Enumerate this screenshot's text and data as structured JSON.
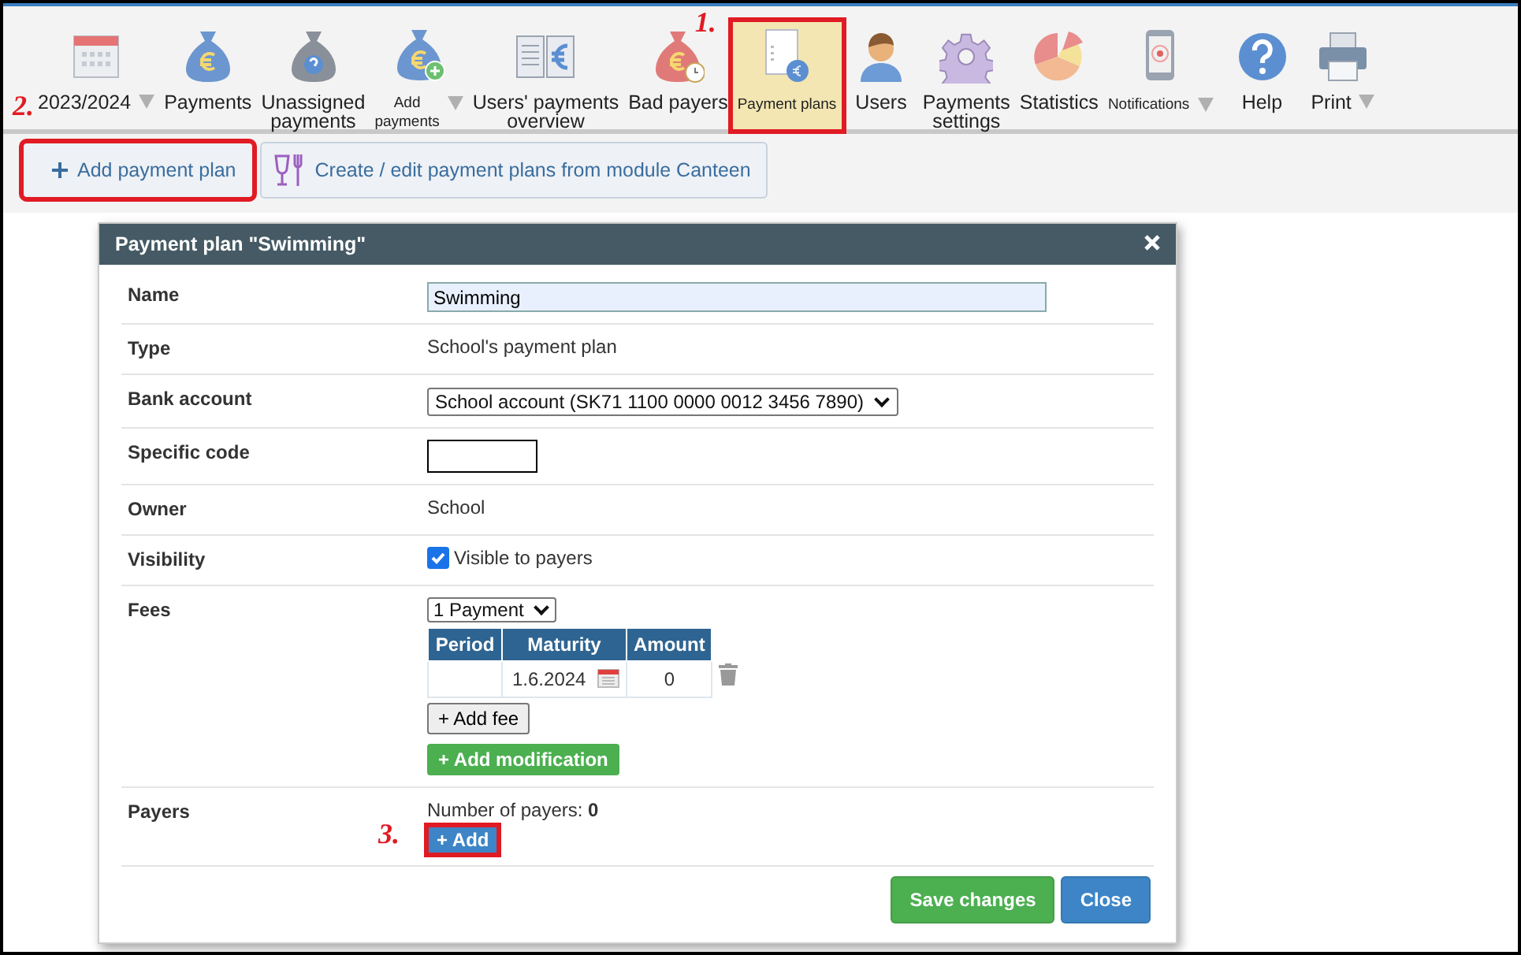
{
  "toolbar": {
    "items": [
      {
        "label": "2023/2024",
        "dropdown": true,
        "small": false,
        "selected": false,
        "marked": false
      },
      {
        "label": "Payments",
        "dropdown": false,
        "small": false,
        "selected": false,
        "marked": false
      },
      {
        "label": "Unassigned payments",
        "dropdown": false,
        "small": false,
        "selected": false,
        "marked": false
      },
      {
        "label": "Add payments",
        "dropdown": true,
        "small": true,
        "selected": false,
        "marked": false
      },
      {
        "label": "Users' payments overview",
        "dropdown": false,
        "small": false,
        "selected": false,
        "marked": false
      },
      {
        "label": "Bad payers",
        "dropdown": false,
        "small": false,
        "selected": false,
        "marked": false
      },
      {
        "label": "Payment plans",
        "dropdown": false,
        "small": true,
        "selected": true,
        "marked": true,
        "callout": "1."
      },
      {
        "label": "Users",
        "dropdown": false,
        "small": false,
        "selected": false,
        "marked": false
      },
      {
        "label": "Payments settings",
        "dropdown": false,
        "small": false,
        "selected": false,
        "marked": false
      },
      {
        "label": "Statistics",
        "dropdown": false,
        "small": false,
        "selected": false,
        "marked": false
      },
      {
        "label": "Notifications",
        "dropdown": true,
        "small": true,
        "selected": false,
        "marked": false
      },
      {
        "label": "Help",
        "dropdown": false,
        "small": false,
        "selected": false,
        "marked": false
      },
      {
        "label": "Print",
        "dropdown": true,
        "small": false,
        "selected": false,
        "marked": false
      }
    ]
  },
  "actions": [
    {
      "label": "Add payment plan",
      "marked": true,
      "callout": "2."
    },
    {
      "label": "Create / edit payment plans from module Canteen",
      "marked": false
    }
  ],
  "dialog": {
    "title": "Payment plan \"Swimming\"",
    "rows": [
      {
        "label": "Name",
        "kind": "input",
        "value": "Swimming"
      },
      {
        "label": "Type",
        "kind": "text",
        "value": "School's payment plan"
      },
      {
        "label": "Bank account",
        "kind": "select",
        "value": "School account (SK71 1100 0000 0012 3456 7890)"
      },
      {
        "label": "Specific code",
        "kind": "short-input"
      },
      {
        "label": "Owner",
        "kind": "text",
        "value": "School"
      },
      {
        "label": "Visibility",
        "kind": "checkbox",
        "value": "Visible to payers",
        "checked": true
      },
      {
        "label": "Fees",
        "kind": "fees",
        "count": "1 Payment",
        "columns": [
          "Period",
          "Maturity",
          "Amount"
        ],
        "fees": [
          {
            "maturity": "1.6.2024",
            "amount": "0"
          }
        ],
        "add_fee": "+ Add fee",
        "add_modification": "+ Add modification"
      },
      {
        "label": "Payers",
        "kind": "payers",
        "value": "Number of payers: **0**",
        "button": "+ Add",
        "marked": true,
        "callout": "3."
      }
    ],
    "buttons": [
      {
        "label": "Save changes",
        "kind": "success"
      },
      {
        "label": "Close",
        "kind": "primary"
      }
    ]
  }
}
